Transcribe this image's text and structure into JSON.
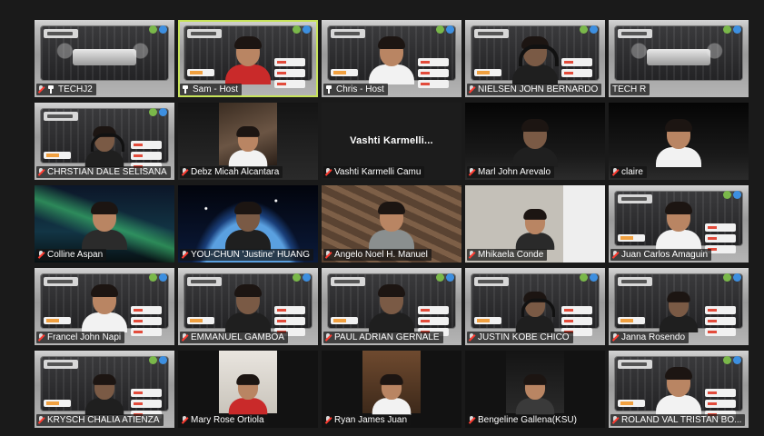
{
  "meeting": {
    "participants": [
      {
        "name": "TECHJ2",
        "muted": true,
        "pinned": true,
        "camera": "vbg-empty"
      },
      {
        "name": "Sam - Host",
        "muted": false,
        "pinned": true,
        "camera": "vbg",
        "active": true
      },
      {
        "name": "Chris - Host",
        "muted": false,
        "pinned": true,
        "camera": "vbg"
      },
      {
        "name": "NIELSEN JOHN BERNARDO",
        "muted": true,
        "camera": "vbg"
      },
      {
        "name": "TECH R",
        "muted": false,
        "camera": "vbg-empty"
      },
      {
        "name": "CHRSTIAN DALE SELISANA",
        "muted": true,
        "camera": "vbg"
      },
      {
        "name": "Debz Micah Alcantara",
        "muted": true,
        "camera": "room"
      },
      {
        "name": "Vashti Karmelli Camu",
        "muted": true,
        "camera": "off",
        "display_name": "Vashti  Karmelli..."
      },
      {
        "name": "Marl John Arevalo",
        "muted": true,
        "camera": "dark"
      },
      {
        "name": "claire",
        "muted": true,
        "camera": "dark"
      },
      {
        "name": "Colline Aspan",
        "muted": true,
        "camera": "aurora"
      },
      {
        "name": "YOU-CHUN 'Justine' HUANG",
        "muted": true,
        "camera": "earth"
      },
      {
        "name": "Angelo Noel H. Manuel",
        "muted": true,
        "camera": "stairs"
      },
      {
        "name": "Mhikaela Conde",
        "muted": true,
        "camera": "kitchen"
      },
      {
        "name": "Juan Carlos Amaguin",
        "muted": true,
        "camera": "vbg"
      },
      {
        "name": "Francel John Napi",
        "muted": true,
        "camera": "vbg"
      },
      {
        "name": "EMMANUEL GAMBOA",
        "muted": true,
        "camera": "vbg"
      },
      {
        "name": "PAUL ADRIAN GERNALE",
        "muted": true,
        "camera": "vbg"
      },
      {
        "name": "JUSTIN KOBE CHICO",
        "muted": true,
        "camera": "vbg"
      },
      {
        "name": "Janna Rosendo",
        "muted": true,
        "camera": "vbg"
      },
      {
        "name": "KRYSCH CHALIA ATIENZA",
        "muted": true,
        "camera": "vbg"
      },
      {
        "name": "Mary Rose Ortiola",
        "muted": true,
        "camera": "wall"
      },
      {
        "name": "Ryan James Juan",
        "muted": true,
        "camera": "wood"
      },
      {
        "name": "Bengeline Gallena(KSU)",
        "muted": true,
        "camera": "dim"
      },
      {
        "name": "ROLAND VAL TRISTAN BO...",
        "muted": true,
        "camera": "vbg"
      }
    ]
  },
  "icons": {
    "muted": "mic-muted-icon",
    "pinned": "pin-icon"
  },
  "colors": {
    "background": "#1a1a1a",
    "active_speaker": "#c7e35a",
    "muted_slash": "#ff3b30"
  }
}
